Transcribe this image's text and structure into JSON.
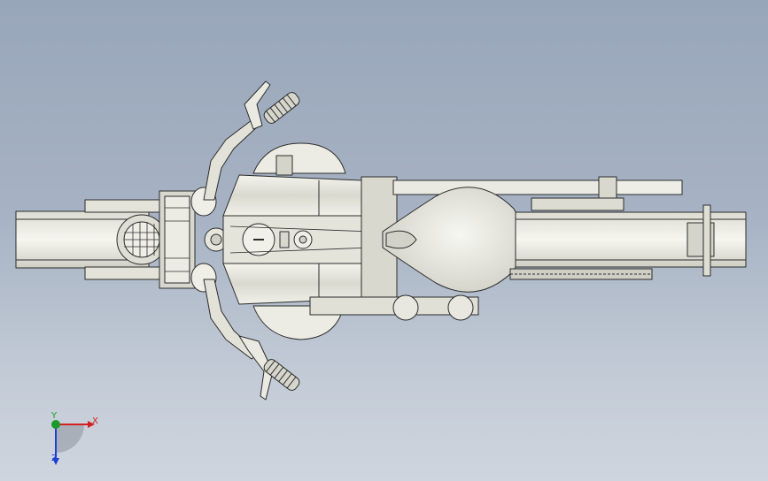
{
  "viewport": {
    "background_top": "#98a6ba",
    "background_bottom": "#cfd5de"
  },
  "model": {
    "fill": "#e7e7df",
    "fill_shadow": "#c9c9bf",
    "edge": "#2c2c2c"
  },
  "triad": {
    "x_label": "X",
    "y_label": "Y",
    "z_label": "Z",
    "x_color": "#d42020",
    "y_color": "#1a9a2a",
    "z_color": "#2040d0"
  }
}
